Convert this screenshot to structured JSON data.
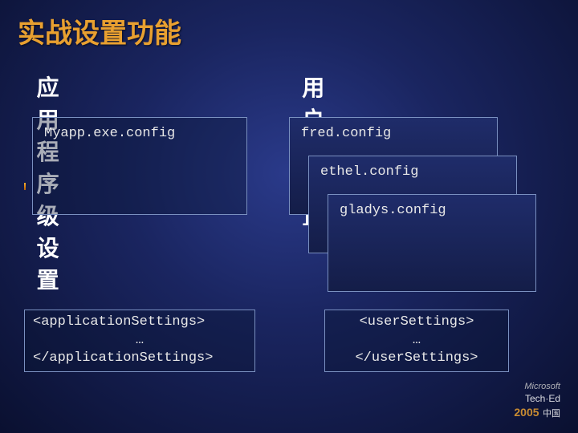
{
  "title": "实战设置功能",
  "left": {
    "heading": "应用程序级设置",
    "config_file": "Myapp.exe.config",
    "code_open": "<applicationSettings>",
    "code_mid": "…",
    "code_close": "</applicationSettings>"
  },
  "right": {
    "heading": "用户级设置",
    "files": [
      "fred.config",
      "ethel.config",
      "gladys.config"
    ],
    "code_open": "<userSettings>",
    "code_mid": "…",
    "code_close": "</userSettings>"
  },
  "footer": {
    "brand_small": "Microsoft",
    "brand": "Tech·Ed",
    "year": "2005",
    "region": "中国"
  }
}
